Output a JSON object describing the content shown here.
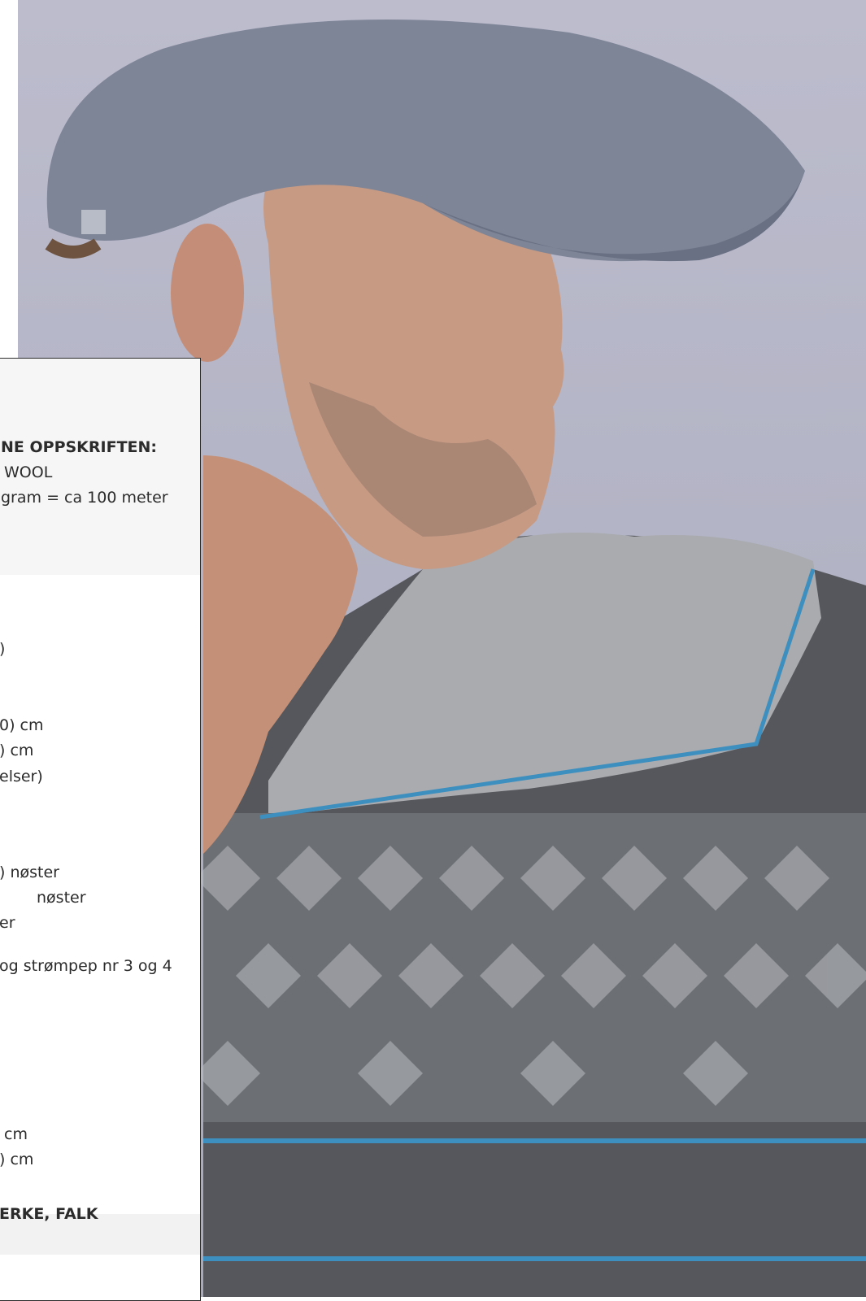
{
  "image": {
    "subject": "photograph",
    "colors": {
      "background": "#b6b7c8",
      "cap": "#7e8597",
      "sweater_dark": "#55575c",
      "sweater_light": "#a9abaf",
      "accent_stripe": "#3c8fbf"
    }
  },
  "panel": {
    "heading": "NE OPPSKRIFTEN:",
    "yarn_name": "WOOL",
    "yarn_weight": "gram = ca 100 meter",
    "size_paren": ")",
    "measure_1": "0)   cm",
    "measure_2": ")    cm",
    "measure_3": "elser)",
    "qty_1": ")    nøster",
    "qty_2": "nøster",
    "qty_3": "er",
    "needles": "og strømpep nr 3 og 4",
    "gauge_1": "cm",
    "gauge_2": ") cm",
    "footer": "ERKE, FALK"
  }
}
